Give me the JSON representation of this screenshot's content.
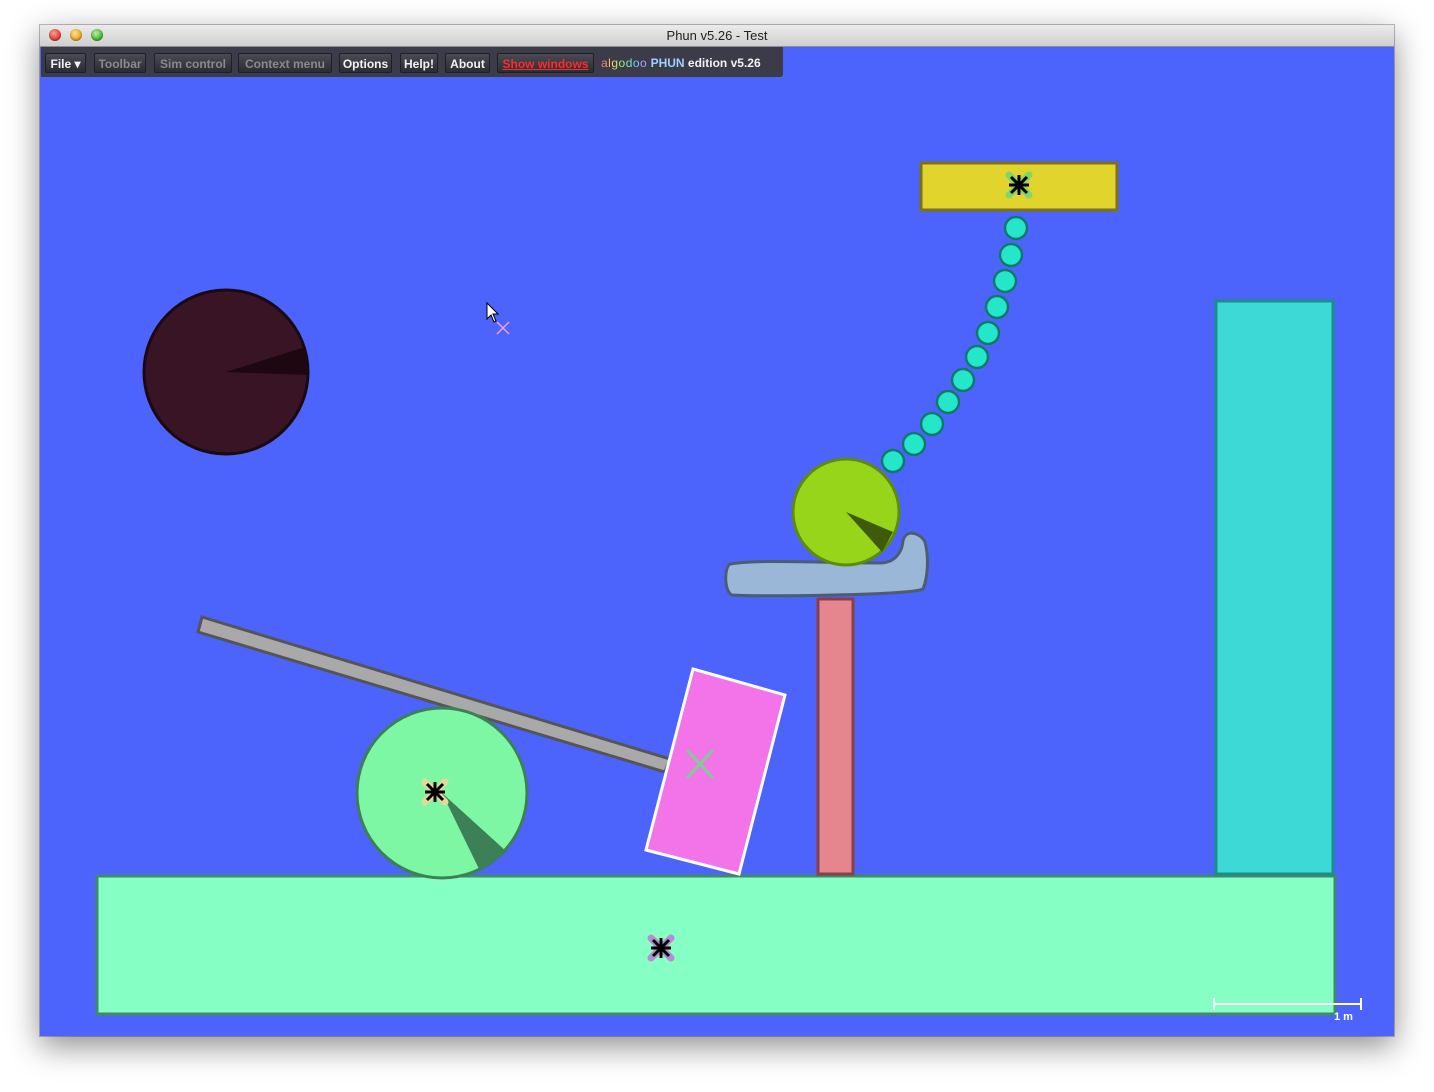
{
  "window": {
    "title": "Phun v5.26 - Test"
  },
  "menu": {
    "file": "File ▾",
    "toolbar": "Toolbar",
    "sim_control": "Sim control",
    "context_menu": "Context menu",
    "options": "Options",
    "help": "Help!",
    "about": "About",
    "show_windows": "Show windows"
  },
  "brand": {
    "algodoo": "algodoo",
    "phun": "PHUN",
    "edition": "edition",
    "version": "v5.26"
  },
  "scale": {
    "label": "1 m"
  },
  "colors": {
    "background": "#4c64fc",
    "ground": "#86ffc4",
    "yellow_block": "#e1d52d",
    "teal_column": "#3dd9d6",
    "pink_pillar": "#e5868f",
    "magenta_box": "#f374e8",
    "lime_ball": "#97d51a",
    "mint_wheel": "#7ef7a5",
    "dark_ball": "#381425",
    "chain_bead": "#24e6c8",
    "plank": "#a9a9a9",
    "tray": "#9ab7d7"
  },
  "icons": {
    "hinge": "hinge-icon",
    "cursor": "mouse-pointer-icon",
    "center_mark": "center-cross-icon"
  }
}
